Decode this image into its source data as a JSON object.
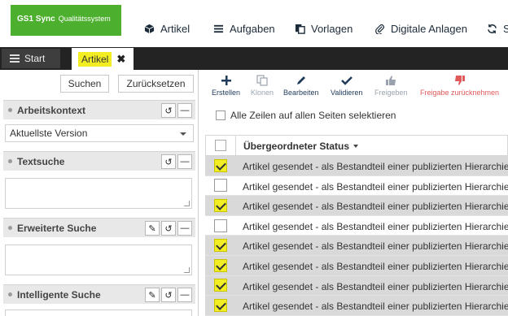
{
  "header": {
    "logo_brand": "GS1 Sync",
    "logo_sub": "Qualitätssystem",
    "nav": [
      {
        "label": "Artikel",
        "icon": "cube-icon"
      },
      {
        "label": "Aufgaben",
        "icon": "list-icon"
      },
      {
        "label": "Vorlagen",
        "icon": "copy-icon"
      },
      {
        "label": "Digitale Anlagen",
        "icon": "paperclip-icon"
      },
      {
        "label": "S",
        "icon": "refresh-icon"
      }
    ]
  },
  "tabs": {
    "start_label": "Start",
    "active_label": "Artikel",
    "close_glyph": "✖"
  },
  "left": {
    "search_button": "Suchen",
    "reset_button": "Zurücksetzen",
    "sections": [
      {
        "title": "Arbeitskontext"
      },
      {
        "title": "Textsuche"
      },
      {
        "title": "Erweiterte Suche"
      },
      {
        "title": "Intelligente Suche"
      }
    ],
    "context_select_value": "Aktuellste Version"
  },
  "toolbar": {
    "items": [
      {
        "label": "Erstellen",
        "enabled": true
      },
      {
        "label": "Klonen",
        "enabled": false
      },
      {
        "label": "Bearbeiten",
        "enabled": true
      },
      {
        "label": "Validieren",
        "enabled": true
      },
      {
        "label": "Freigeben",
        "enabled": false
      },
      {
        "label": "Freigabe zurücknehmen",
        "enabled": false
      }
    ]
  },
  "select_all_label": "Alle Zeilen auf allen Seiten selektieren",
  "table": {
    "column_header": "Übergeordneter Status",
    "rows": [
      {
        "status": "Artikel gesendet - als Bestandteil einer publizierten Hierarchie",
        "selected": true
      },
      {
        "status": "Artikel gesendet - als Bestandteil einer publizierten Hierarchie",
        "selected": false
      },
      {
        "status": "Artikel gesendet - als Bestandteil einer publizierten Hierarchie",
        "selected": true
      },
      {
        "status": "Artikel gesendet - als Bestandteil einer publizierten Hierarchie",
        "selected": false
      },
      {
        "status": "Artikel gesendet - als Bestandteil einer publizierten Hierarchie",
        "selected": true
      },
      {
        "status": "Artikel gesendet - als Bestandteil einer publizierten Hierarchie",
        "selected": true
      },
      {
        "status": "Artikel gesendet - als Bestandteil einer publizierten Hierarchie",
        "selected": true
      },
      {
        "status": "Artikel gesendet - als Bestandteil einer publizierten Hierarchie",
        "selected": true
      }
    ]
  },
  "colors": {
    "brand_green": "#4caf2e",
    "highlight_yellow": "#f2ee23",
    "toolbar_blue": "#1f3a5a",
    "disabled_gray": "#9aa3ad",
    "disabled_red": "#e05a5a"
  }
}
